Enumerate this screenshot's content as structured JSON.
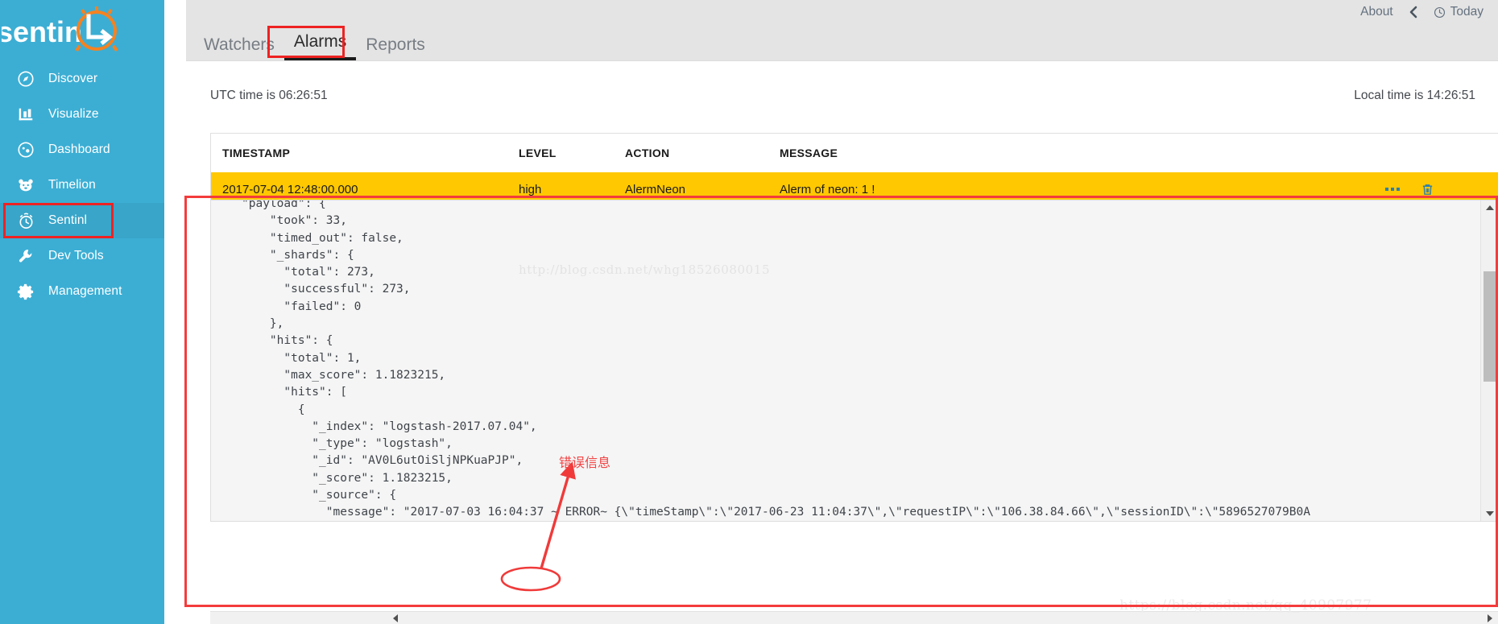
{
  "app": {
    "logo_text": "sentinl"
  },
  "sidebar": {
    "items": [
      {
        "label": "Discover",
        "icon": "compass-icon"
      },
      {
        "label": "Visualize",
        "icon": "bar-chart-icon"
      },
      {
        "label": "Dashboard",
        "icon": "dashboard-icon"
      },
      {
        "label": "Timelion",
        "icon": "timelion-bear-icon"
      },
      {
        "label": "Sentinl",
        "icon": "alarm-clock-icon"
      },
      {
        "label": "Dev Tools",
        "icon": "wrench-icon"
      },
      {
        "label": "Management",
        "icon": "gear-icon"
      }
    ],
    "active": "Sentinl"
  },
  "topbar": {
    "about_label": "About",
    "back_label": "",
    "today_label": "Today"
  },
  "tabs": [
    {
      "label": "Watchers",
      "active": false
    },
    {
      "label": "Alarms",
      "active": true
    },
    {
      "label": "Reports",
      "active": false
    }
  ],
  "time": {
    "utc": "UTC time is 06:26:51",
    "local": "Local time is 14:26:51"
  },
  "table": {
    "columns": [
      "TIMESTAMP",
      "LEVEL",
      "ACTION",
      "MESSAGE"
    ],
    "rows": [
      {
        "timestamp": "2017-07-04 12:48:00.000",
        "level": "high",
        "action": "AlermNeon",
        "message": "Alerm of neon: 1 !",
        "menu_icon": "ellipsis-icon",
        "delete_icon": "trash-icon"
      }
    ]
  },
  "payload": {
    "text": "\"payload\": {\n    \"took\": 33,\n    \"timed_out\": false,\n    \"_shards\": {\n      \"total\": 273,\n      \"successful\": 273,\n      \"failed\": 0\n    },\n    \"hits\": {\n      \"total\": 1,\n      \"max_score\": 1.1823215,\n      \"hits\": [\n        {\n          \"_index\": \"logstash-2017.07.04\",\n          \"_type\": \"logstash\",\n          \"_id\": \"AV0L6utOiSljNPKuaPJP\",\n          \"_score\": 1.1823215,\n          \"_source\": {\n            \"message\": \"2017-07-03 16:04:37 ~ ERROR~ {\\\"timeStamp\\\":\\\"2017-06-23 11:04:37\\\",\\\"requestIP\\\":\\\"106.38.84.66\\\",\\\"sessionID\\\":\\\"5896527079B0A"
  },
  "annotations": {
    "error_label": "错误信息",
    "highlight_color": "#ee2222"
  },
  "watermarks": {
    "main": "http://blog.csdn.net/whg18526080015",
    "secondary": "https://blog.csdn.net/qq_40907977"
  },
  "colors": {
    "sidebar": "#3caed4",
    "alarm_row": "#ffc800",
    "annotation_red": "#ee2222",
    "icon_blue": "#2e7fa8"
  }
}
